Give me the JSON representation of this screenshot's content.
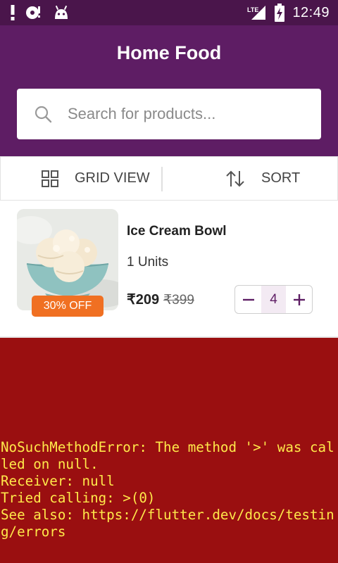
{
  "status_bar": {
    "time": "12:49",
    "network_label": "LTE",
    "icons": [
      "alert-icon",
      "sync-icon",
      "android-icon",
      "lte-signal-icon",
      "battery-charging-icon"
    ]
  },
  "app_bar": {
    "title": "Home Food",
    "background_color": "#5e1d64"
  },
  "search": {
    "placeholder": "Search for products...",
    "value": "",
    "icon": "search-icon"
  },
  "toolbar": {
    "grid_label": "GRID VIEW",
    "grid_icon": "grid-view-icon",
    "sort_label": "SORT",
    "sort_icon": "sort-icon"
  },
  "product": {
    "name": "Ice Cream Bowl",
    "units": "1 Units",
    "price": "₹209",
    "original_price": "₹399",
    "discount": "30% OFF",
    "quantity": "4",
    "accent_color": "#f07022"
  },
  "error": {
    "message": "NoSuchMethodError: The method '>' was called on null.\nReceiver: null\nTried calling: >(0)\nSee also: https://flutter.dev/docs/testing/errors",
    "background_color": "#9a0f10",
    "text_color": "#ffe94a"
  }
}
